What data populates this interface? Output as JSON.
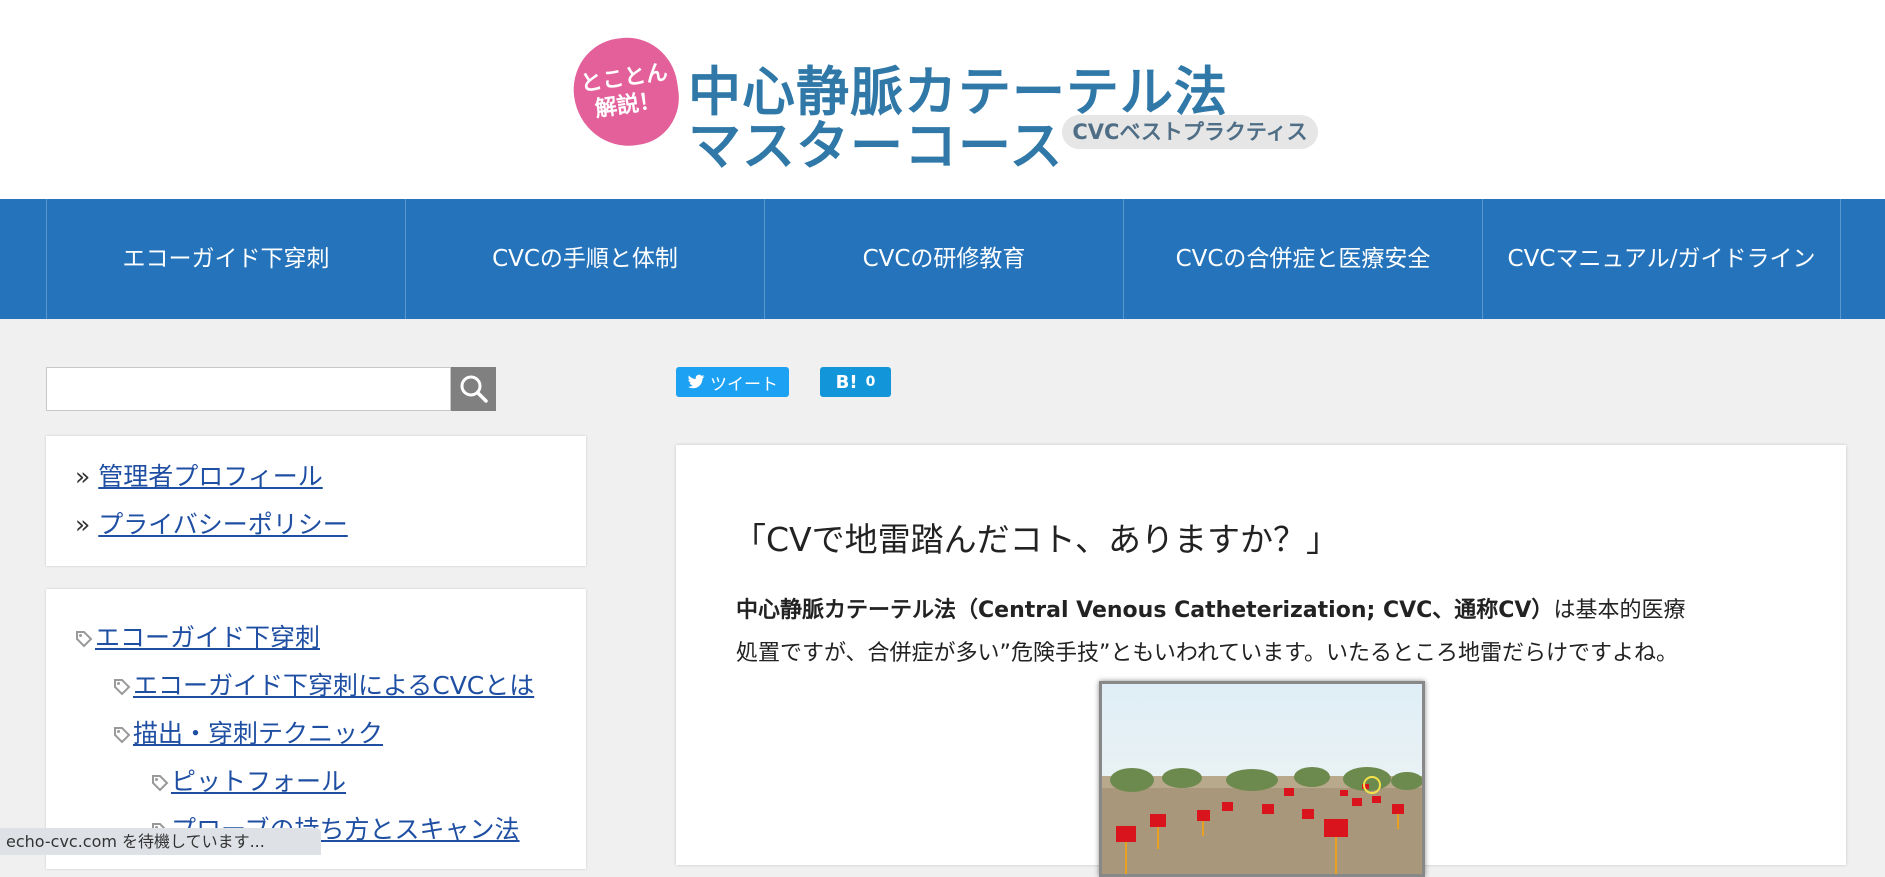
{
  "header": {
    "logo_badge": "とことん 解説！",
    "logo_badge_line1": "とことん",
    "logo_badge_line2": "解説！",
    "title_line1": "中心静脈カテーテル法",
    "title_line2": "マスターコース",
    "tagline": "CVCベストプラクティス"
  },
  "nav": {
    "items": [
      {
        "label": "エコーガイド下穿刺"
      },
      {
        "label": "CVCの手順と体制"
      },
      {
        "label": "CVCの研修教育"
      },
      {
        "label": "CVCの合併症と医療安全"
      },
      {
        "label": "CVCマニュアル/ガイドライン"
      }
    ]
  },
  "sidebar": {
    "search": {
      "placeholder": "",
      "value": "",
      "icon": "search-icon"
    },
    "profile_links": [
      {
        "bullet": "»",
        "label": "管理者プロフィール"
      },
      {
        "bullet": "»",
        "label": "プライバシーポリシー"
      }
    ],
    "categories": [
      {
        "label": "エコーガイド下穿刺",
        "level": 0,
        "icon": "tag-icon"
      },
      {
        "label": "エコーガイド下穿刺によるCVCとは",
        "level": 1,
        "icon": "tag-icon"
      },
      {
        "label": "描出・穿刺テクニック",
        "level": 1,
        "icon": "tag-icon"
      },
      {
        "label": "ピットフォール",
        "level": 2,
        "icon": "tag-icon"
      },
      {
        "label": "プローブの持ち方とスキャン法",
        "level": 2,
        "icon": "tag-icon"
      }
    ]
  },
  "share": {
    "tweet_label": "ツイート",
    "hatena_label": "B!",
    "hatena_count": "0"
  },
  "article": {
    "title": "「CVで地雷踏んだコト、ありますか？」",
    "intro_bold": "中心静脈カテーテル法（Central Venous Catheterization; CVC、通称CV）",
    "intro_rest_line1": "は基本的医療",
    "intro_rest_line2": "処置ですが、合併症が多い”危険手技”ともいわれています。いたるところ地雷だらけですよね。"
  },
  "status_bar": {
    "text": "echo-cvc.com を待機しています..."
  },
  "colors": {
    "nav_bg": "#2574bb",
    "logo_pink": "#e3609a",
    "logo_blue": "#2f78a8",
    "link": "#1f4fa3",
    "tweet": "#1da1f2",
    "hatena": "#1296d9"
  }
}
